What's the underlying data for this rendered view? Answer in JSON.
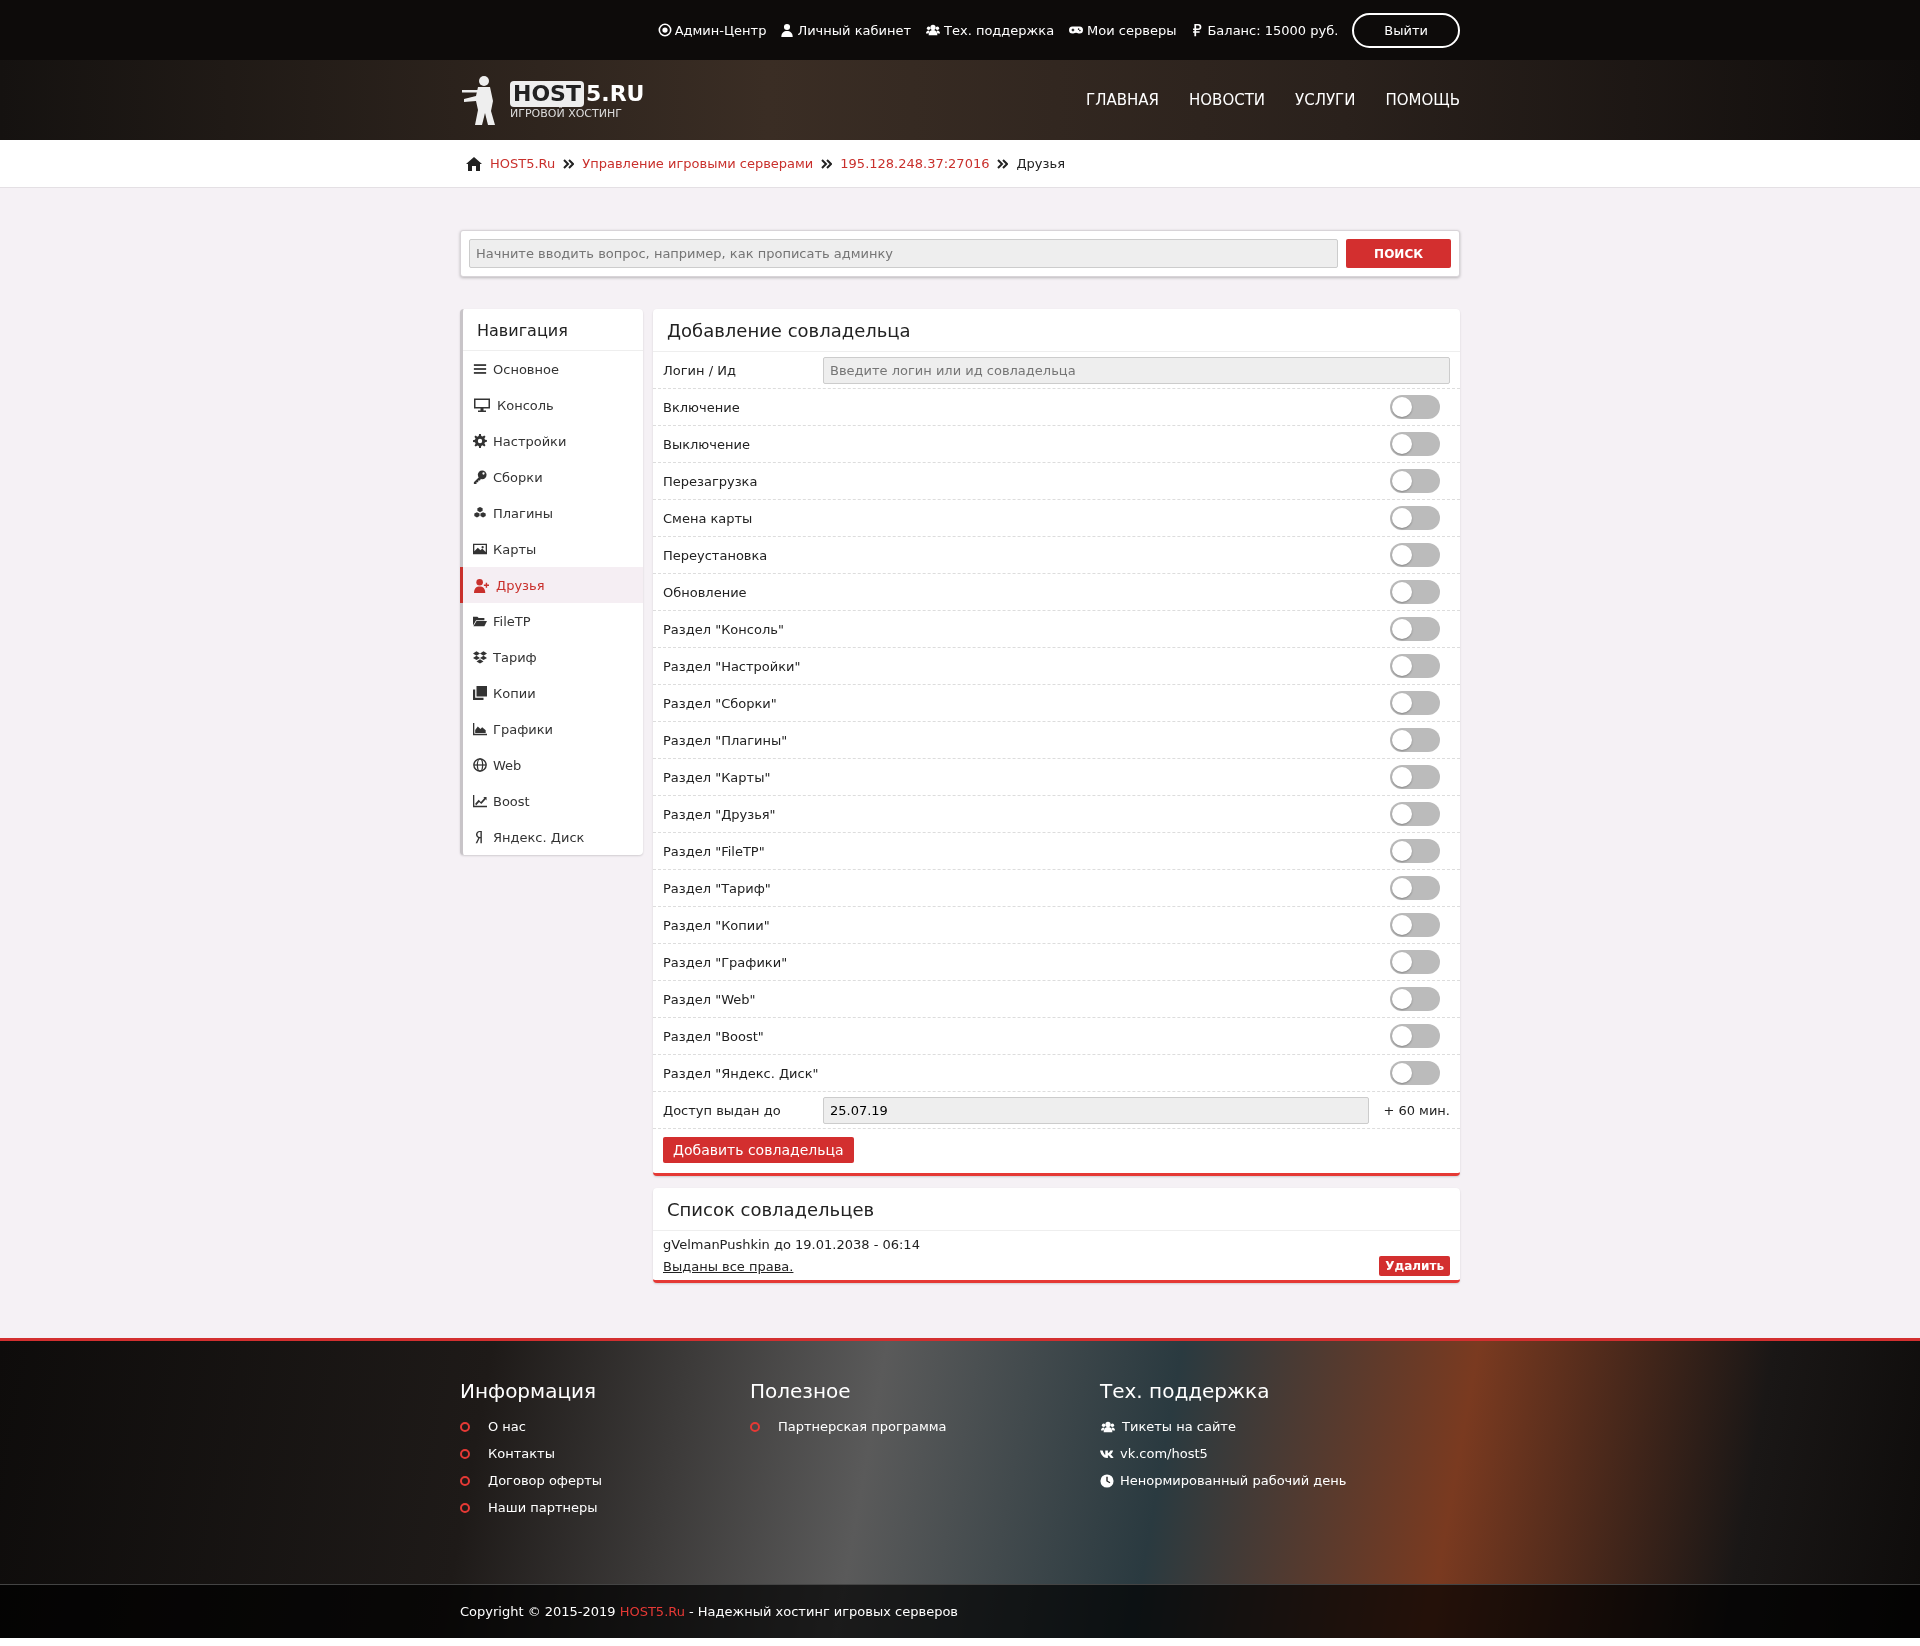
{
  "top_bar": {
    "links": [
      {
        "kind": "target",
        "label": "Админ-Центр"
      },
      {
        "kind": "user",
        "label": "Личный кабинет"
      },
      {
        "kind": "users",
        "label": "Тех. поддержка"
      },
      {
        "kind": "gamepad",
        "label": "Мои серверы"
      },
      {
        "kind": "ruble",
        "label": "Баланс: 15000 руб."
      }
    ],
    "logout_button": "Выйти"
  },
  "header": {
    "logo": {
      "boxed": "HOST",
      "rest": "5.RU",
      "tagline": "ИГРОВОЙ ХОСТИНГ"
    },
    "nav": [
      "ГЛАВНАЯ",
      "НОВОСТИ",
      "УСЛУГИ",
      "ПОМОЩЬ"
    ]
  },
  "breadcrumb": [
    {
      "label": "HOST5.Ru",
      "current": false
    },
    {
      "label": "Управление игровыми серверами",
      "current": false
    },
    {
      "label": "195.128.248.37:27016",
      "current": false
    },
    {
      "label": "Друзья",
      "current": true
    }
  ],
  "search": {
    "placeholder": "Начните вводить вопрос, например, как прописать админку",
    "button": "ПОИСК"
  },
  "sidebar": {
    "title": "Навигация",
    "items": [
      {
        "kind": "bars",
        "label": "Основное",
        "selected": false
      },
      {
        "kind": "monitor",
        "label": "Консоль",
        "selected": false
      },
      {
        "kind": "gear",
        "label": "Настройки",
        "selected": false
      },
      {
        "kind": "key",
        "label": "Сборки",
        "selected": false
      },
      {
        "kind": "cubes",
        "label": "Плагины",
        "selected": false
      },
      {
        "kind": "image",
        "label": "Карты",
        "selected": false
      },
      {
        "kind": "user-plus",
        "label": "Друзья",
        "selected": true
      },
      {
        "kind": "folder",
        "label": "FileTP",
        "selected": false
      },
      {
        "kind": "boxes",
        "label": "Тариф",
        "selected": false
      },
      {
        "kind": "copies",
        "label": "Копии",
        "selected": false
      },
      {
        "kind": "area-chart",
        "label": "Графики",
        "selected": false
      },
      {
        "kind": "globe",
        "label": "Web",
        "selected": false
      },
      {
        "kind": "line-chart",
        "label": "Boost",
        "selected": false
      },
      {
        "kind": "ya",
        "label": "Яндекс. Диск",
        "selected": false
      }
    ]
  },
  "add_form": {
    "title": "Добавление совладельца",
    "login": {
      "label": "Логин / Ид",
      "placeholder": "Введите логин или ид совладельца"
    },
    "permissions": [
      {
        "label": "Включение",
        "on": false
      },
      {
        "label": "Выключение",
        "on": false
      },
      {
        "label": "Перезагрузка",
        "on": false
      },
      {
        "label": "Смена карты",
        "on": false
      },
      {
        "label": "Переустановка",
        "on": false
      },
      {
        "label": "Обновление",
        "on": false
      },
      {
        "label": "Раздел \"Консоль\"",
        "on": false
      },
      {
        "label": "Раздел \"Настройки\"",
        "on": false
      },
      {
        "label": "Раздел \"Сборки\"",
        "on": false
      },
      {
        "label": "Раздел \"Плагины\"",
        "on": false
      },
      {
        "label": "Раздел \"Карты\"",
        "on": false
      },
      {
        "label": "Раздел \"Друзья\"",
        "on": false
      },
      {
        "label": "Раздел \"FileTP\"",
        "on": false
      },
      {
        "label": "Раздел \"Тариф\"",
        "on": false
      },
      {
        "label": "Раздел \"Копии\"",
        "on": false
      },
      {
        "label": "Раздел \"Графики\"",
        "on": false
      },
      {
        "label": "Раздел \"Web\"",
        "on": false
      },
      {
        "label": "Раздел \"Boost\"",
        "on": false
      },
      {
        "label": "Раздел \"Яндекс. Диск\"",
        "on": false
      }
    ],
    "access_until": {
      "label": "Доступ выдан до",
      "value": "25.07.19",
      "extend": "+ 60 мин."
    },
    "submit": "Добавить совладельца"
  },
  "owners": {
    "title": "Список совладельцев",
    "items": [
      {
        "text": "gVelmanPushkin до 19.01.2038 - 06:14",
        "rights": "Выданы все права.",
        "delete": "Удалить"
      }
    ]
  },
  "footer": {
    "columns": [
      {
        "title": "Информация",
        "kind": "bullets",
        "links": [
          {
            "label": "О нас"
          },
          {
            "label": "Контакты"
          },
          {
            "label": "Договор оферты"
          },
          {
            "label": "Наши партнеры"
          }
        ]
      },
      {
        "title": "Полезное",
        "kind": "bullets",
        "links": [
          {
            "label": "Партнерская программа"
          }
        ]
      },
      {
        "title": "Тех. поддержка",
        "kind": "icons",
        "links": [
          {
            "kind": "users",
            "label": "Тикеты на сайте"
          },
          {
            "kind": "vk",
            "label": "vk.com/host5"
          },
          {
            "kind": "clock",
            "label": "Ненормированный рабочий день"
          }
        ]
      }
    ],
    "copyright": {
      "prefix": "Copyright © 2015-2019",
      "brand": "HOST5.Ru",
      "suffix": "- Надежный хостинг игровых серверов"
    }
  }
}
